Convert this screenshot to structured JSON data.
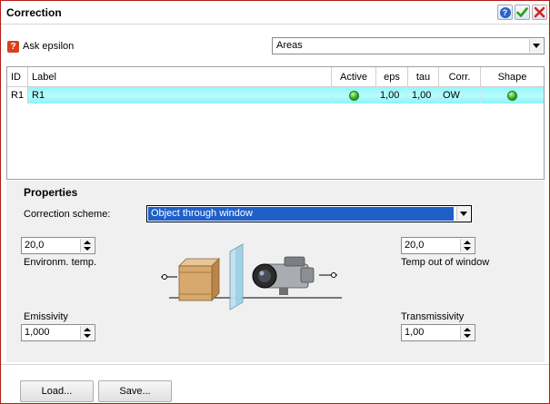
{
  "window": {
    "title": "Correction"
  },
  "toolbar": {
    "ask_epsilon_label": "Ask epsilon",
    "area_select": {
      "value": "Areas"
    }
  },
  "grid": {
    "columns": [
      "ID",
      "Label",
      "Active",
      "eps",
      "tau",
      "Corr.",
      "Shape"
    ],
    "rows": [
      {
        "id": "R1",
        "label": "R1",
        "active": true,
        "eps": "1,00",
        "tau": "1,00",
        "corr": "OW",
        "shape": true
      }
    ]
  },
  "properties": {
    "title": "Properties",
    "scheme_label": "Correction scheme:",
    "scheme_value": "Object through window",
    "environ_temp": {
      "value": "20,0",
      "label": "Environm. temp."
    },
    "temp_out_window": {
      "value": "20,0",
      "label": "Temp out of window"
    },
    "emissivity": {
      "label": "Emissivity",
      "value": "1,000"
    },
    "transmissivity": {
      "label": "Transmissivity",
      "value": "1,00"
    }
  },
  "buttons": {
    "load": "Load...",
    "save": "Save..."
  },
  "colors": {
    "row_highlight": "#a8f8fb",
    "selection": "#1f5fc8",
    "led_green": "#33b01d",
    "window_border": "#b31b1b"
  }
}
